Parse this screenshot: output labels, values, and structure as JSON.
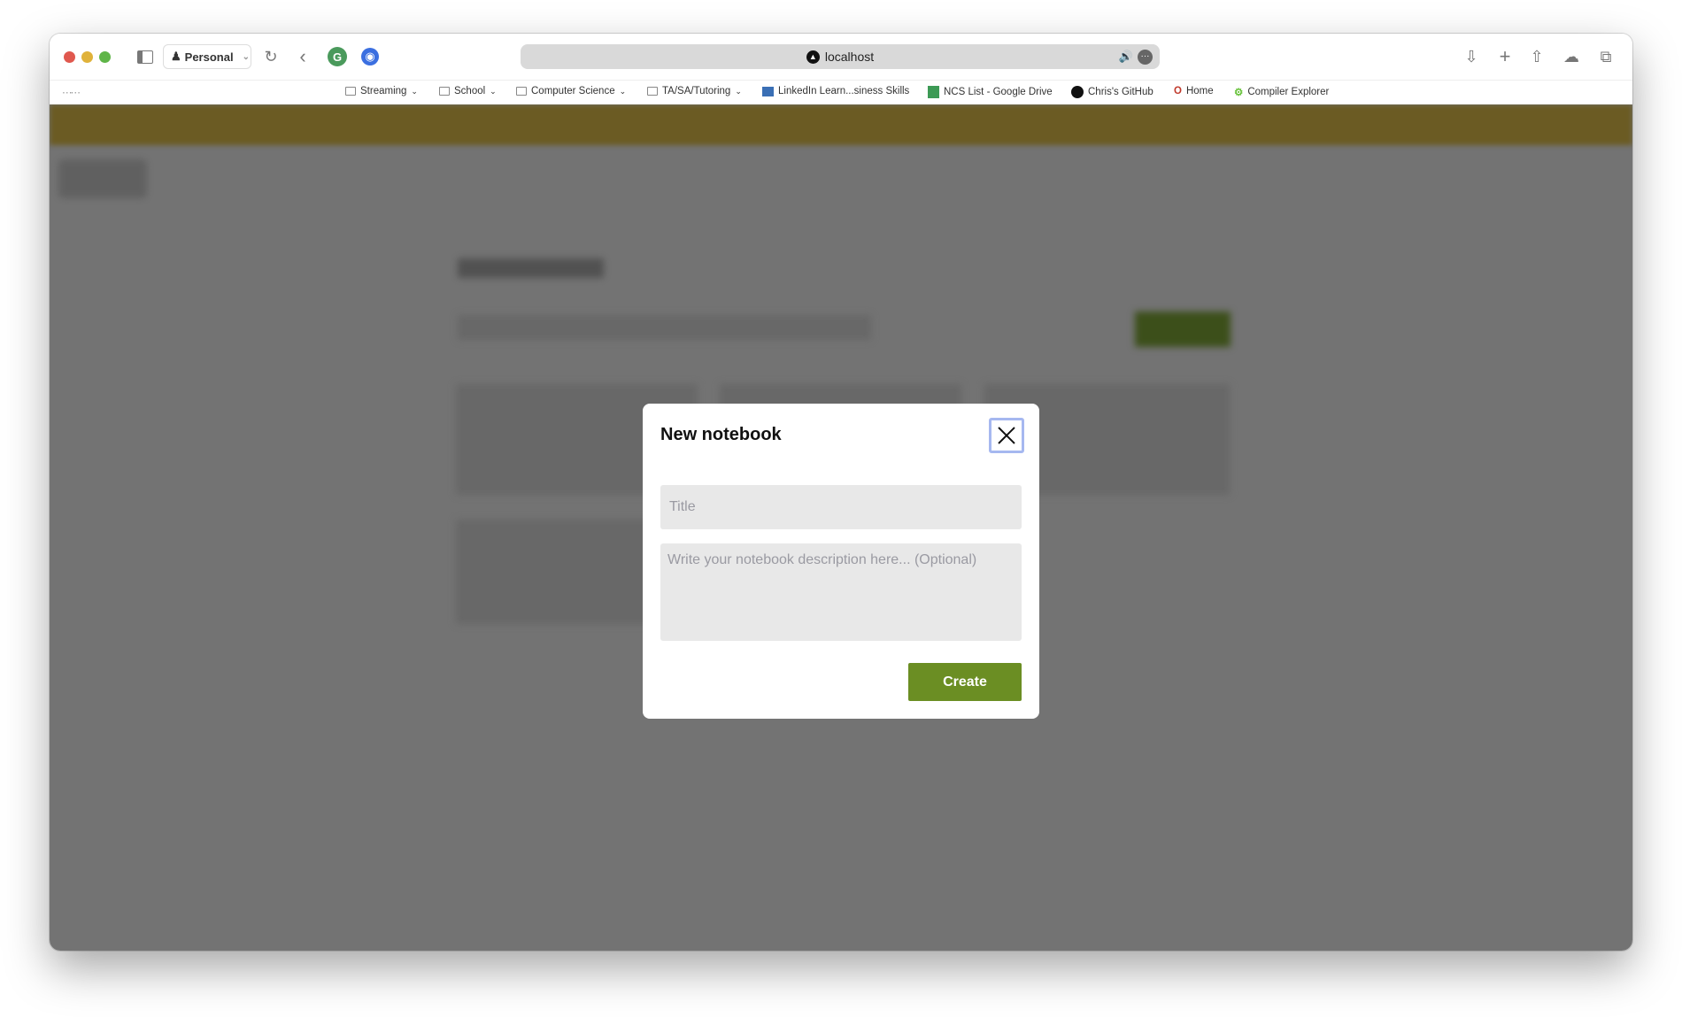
{
  "browser": {
    "profile": "Personal",
    "url": "localhost",
    "bookmarks": [
      {
        "label": "Streaming",
        "folder": true
      },
      {
        "label": "School",
        "folder": true
      },
      {
        "label": "Computer Science",
        "folder": true
      },
      {
        "label": "TA/SA/Tutoring",
        "folder": true
      },
      {
        "label": "LinkedIn Learn...siness Skills",
        "folder": false
      },
      {
        "label": "NCS List - Google Drive",
        "folder": false
      },
      {
        "label": "Chris's GitHub",
        "folder": false
      },
      {
        "label": "Home",
        "folder": false
      },
      {
        "label": "Compiler Explorer",
        "folder": false
      }
    ]
  },
  "modal": {
    "title": "New notebook",
    "title_placeholder": "Title",
    "description_placeholder": "Write your notebook description here... (Optional)",
    "create_label": "Create"
  },
  "colors": {
    "accent": "#6b8e23",
    "banner": "#6b5b23",
    "overlay": "#737373",
    "close_focus": "#a6b8f0"
  }
}
